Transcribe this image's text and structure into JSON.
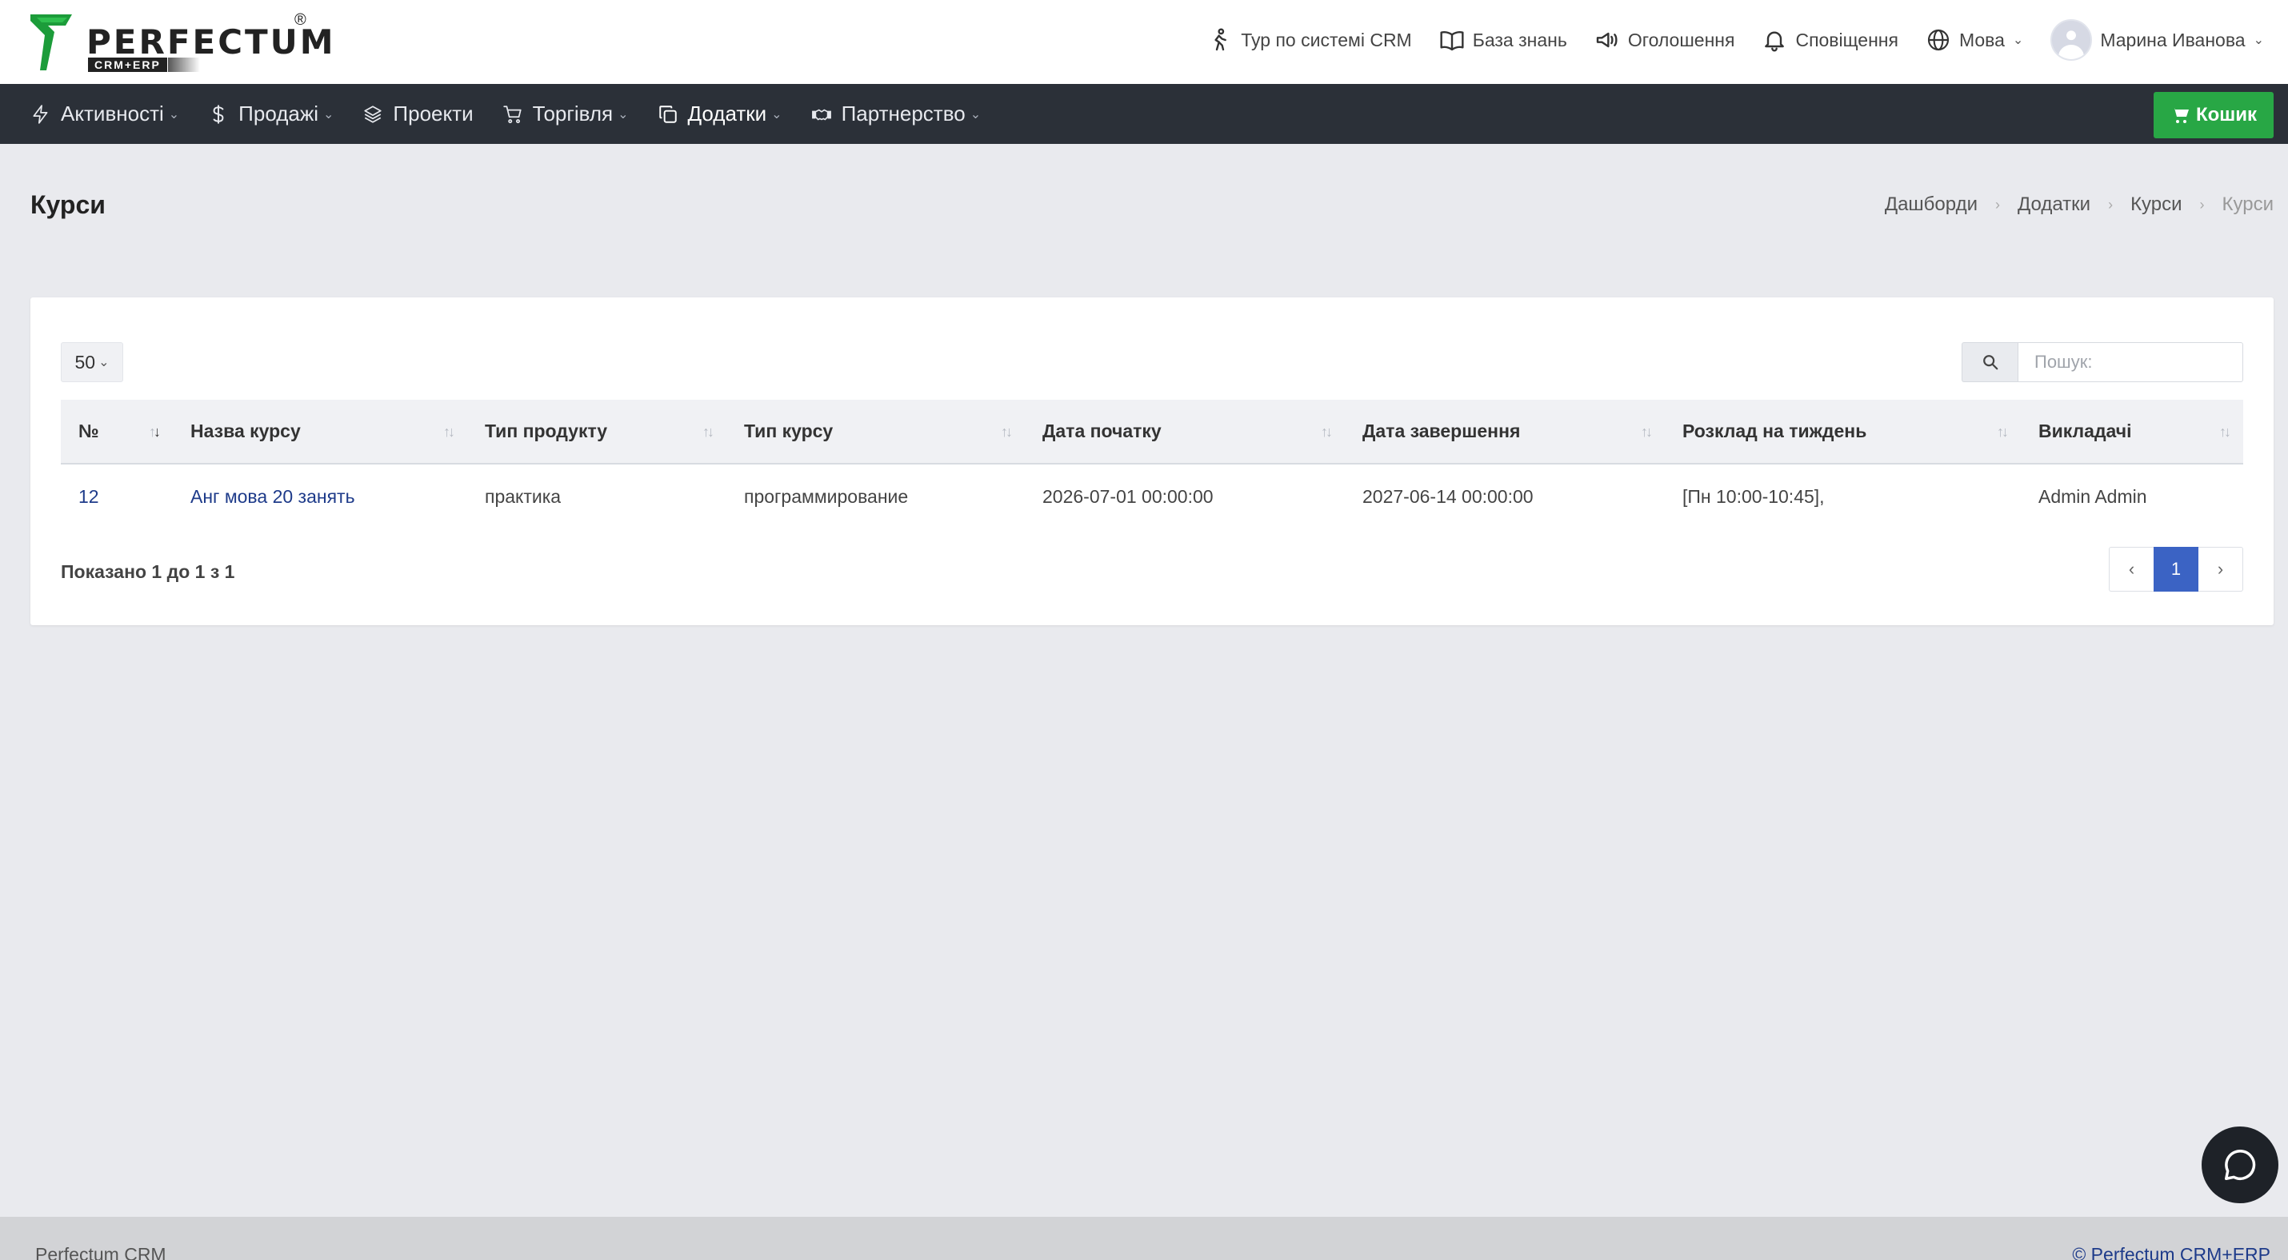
{
  "brand": {
    "name": "PERFECTUM",
    "reg": "®",
    "sub": "CRM+ERP"
  },
  "topnav": {
    "tour": "Тур по системі CRM",
    "knowledge": "База знань",
    "announcements": "Оголошення",
    "notifications": "Сповіщення",
    "language": "Мова",
    "user": "Марина Иванова"
  },
  "mainnav": {
    "items": [
      {
        "label": "Активності"
      },
      {
        "label": "Продажі"
      },
      {
        "label": "Проекти"
      },
      {
        "label": "Торгівля"
      },
      {
        "label": "Додатки"
      },
      {
        "label": "Партнерство"
      }
    ],
    "cart": "Кошик",
    "cart_color": "#28a745"
  },
  "page": {
    "title": "Курси",
    "breadcrumb": [
      "Дашборди",
      "Додатки",
      "Курси",
      "Курси"
    ]
  },
  "table": {
    "length": "50",
    "search_placeholder": "Пошук:",
    "columns": [
      "№",
      "Назва курсу",
      "Тип продукту",
      "Тип курсу",
      "Дата початку",
      "Дата завершення",
      "Розклад на тиждень",
      "Викладачі"
    ],
    "rows": [
      [
        "12",
        "Анг мова 20 занять",
        "практика",
        "программирование",
        "2026-07-01 00:00:00",
        "2027-06-14 00:00:00",
        "[Пн 10:00-10:45],",
        "Admin Admin"
      ]
    ],
    "info": "Показано 1 до 1 з 1",
    "page": "1"
  },
  "footer": {
    "left": "Perfectum CRM",
    "right": "© Perfectum CRM+ERP"
  },
  "colors": {
    "accent": "#3b63c4",
    "nav": "#2b3038",
    "link": "#1e3b8a"
  }
}
